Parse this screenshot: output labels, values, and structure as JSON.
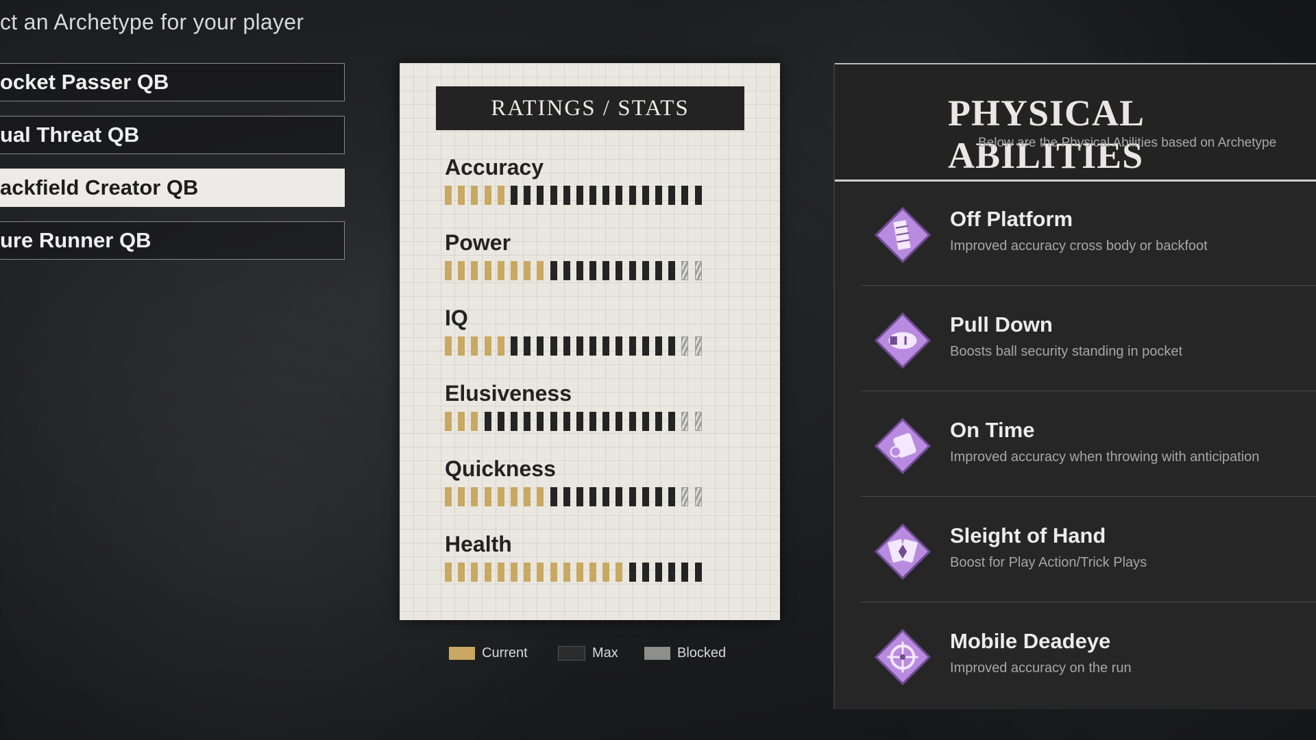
{
  "prompt": "ct an Archetype for your player",
  "archetypes": [
    {
      "label": "ocket Passer QB"
    },
    {
      "label": "ual Threat QB"
    },
    {
      "label": "ackfield Creator QB"
    },
    {
      "label": "ure Runner QB"
    }
  ],
  "selected_archetype_index": 2,
  "ratings": {
    "title": "RATINGS / STATS",
    "total_segments": 20,
    "stats": [
      {
        "label": "Accuracy",
        "current": 5,
        "blocked": 0
      },
      {
        "label": "Power",
        "current": 8,
        "blocked": 2
      },
      {
        "label": "IQ",
        "current": 5,
        "blocked": 2
      },
      {
        "label": "Elusiveness",
        "current": 3,
        "blocked": 2
      },
      {
        "label": "Quickness",
        "current": 8,
        "blocked": 2
      },
      {
        "label": "Health",
        "current": 14,
        "blocked": 0
      }
    ]
  },
  "legend": {
    "current": "Current",
    "max": "Max",
    "blocked": "Blocked"
  },
  "colors": {
    "current": "#c9a862",
    "max": "#242424",
    "blocked": "#9d9d9a",
    "ability_icon": "#b98be0"
  },
  "abilities": {
    "title": "PHYSICAL ABILITIES",
    "subtitle": "Below are the Physical Abilities based on Archetype",
    "items": [
      {
        "name": "Off Platform",
        "desc": "Improved accuracy cross body or backfoot",
        "icon": "leaning-tower-icon"
      },
      {
        "name": "Pull Down",
        "desc": "Boosts ball security standing in pocket",
        "icon": "football-hand-icon"
      },
      {
        "name": "On Time",
        "desc": "Improved accuracy when throwing with anticipation",
        "icon": "stopwatch-icon"
      },
      {
        "name": "Sleight of Hand",
        "desc": "Boost for Play Action/Trick Plays",
        "icon": "playing-cards-icon"
      },
      {
        "name": "Mobile Deadeye",
        "desc": "Improved accuracy on the run",
        "icon": "crosshair-icon"
      }
    ]
  }
}
